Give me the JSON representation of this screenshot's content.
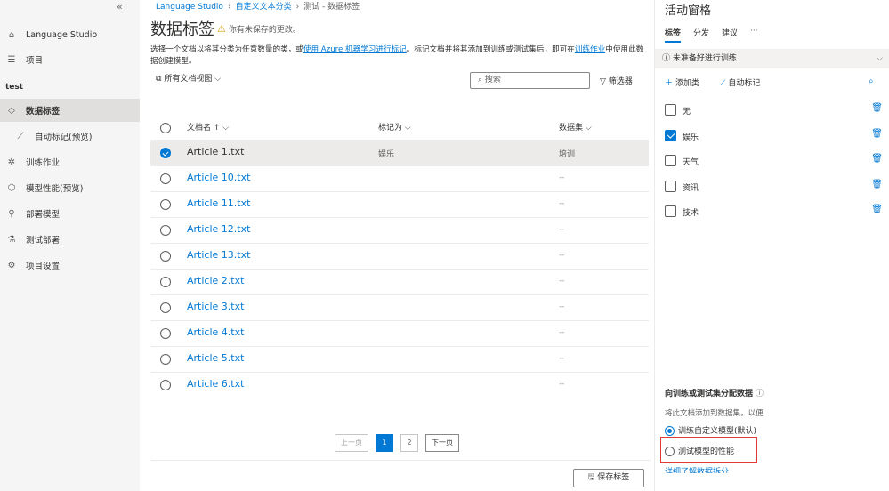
{
  "sidebar": {
    "collapse_glyph": "«",
    "items": [
      {
        "label": "Language Studio",
        "icon": "home-icon"
      },
      {
        "label": "项目",
        "icon": "list-icon"
      }
    ],
    "project_name": "test",
    "project_items": [
      {
        "label": "数据标签",
        "icon": "tag-icon",
        "active": true
      },
      {
        "label": "自动标记(预览)",
        "icon": "wand-icon",
        "sub": true
      },
      {
        "label": "训练作业",
        "icon": "training-icon"
      },
      {
        "label": "模型性能(预览)",
        "icon": "model-icon"
      },
      {
        "label": "部署模型",
        "icon": "deploy-icon"
      },
      {
        "label": "测试部署",
        "icon": "flask-icon"
      },
      {
        "label": "项目设置",
        "icon": "gear-icon"
      }
    ]
  },
  "breadcrumb": {
    "items": [
      "Language Studio",
      "自定义文本分类",
      "测试 - 数据标签"
    ]
  },
  "page": {
    "title": "数据标签",
    "warning": "你有未保存的更改。",
    "desc_part1": "选择一个文档以将其分类为任意数量的类，或",
    "desc_link1": "使用 Azure 机器学习进行标记",
    "desc_part2": "。标记文档并将其添加到训练或测试集后，即可在",
    "desc_link2": "训练作业",
    "desc_part3": "中使用此数据创建模型。",
    "view_selector": "所有文档视图",
    "search_placeholder": "搜索",
    "filter_label": "筛选器"
  },
  "table": {
    "headers": {
      "name": "文档名 ↑",
      "tag": "标记为",
      "dataset": "数据集"
    },
    "rows": [
      {
        "name": "Article 1.txt",
        "tag": "娱乐",
        "dataset": "培训",
        "selected": true
      },
      {
        "name": "Article 10.txt",
        "tag": "",
        "dataset": "--"
      },
      {
        "name": "Article 11.txt",
        "tag": "",
        "dataset": "--"
      },
      {
        "name": "Article 12.txt",
        "tag": "",
        "dataset": "--"
      },
      {
        "name": "Article 13.txt",
        "tag": "",
        "dataset": "--"
      },
      {
        "name": "Article 2.txt",
        "tag": "",
        "dataset": "--"
      },
      {
        "name": "Article 3.txt",
        "tag": "",
        "dataset": "--"
      },
      {
        "name": "Article 4.txt",
        "tag": "",
        "dataset": "--"
      },
      {
        "name": "Article 5.txt",
        "tag": "",
        "dataset": "--"
      },
      {
        "name": "Article 6.txt",
        "tag": "",
        "dataset": "--"
      }
    ]
  },
  "pager": {
    "prev": "上一页",
    "pages": [
      "1",
      "2"
    ],
    "current": "1",
    "next": "下一页"
  },
  "save_button": "保存标签",
  "pane": {
    "title": "活动窗格",
    "tabs": [
      "标签",
      "分发",
      "建议"
    ],
    "more": "···",
    "notice": "未准备好进行训练",
    "add_class": "添加类",
    "auto_label": "自动标记",
    "labels": [
      {
        "name": "无",
        "checked": false
      },
      {
        "name": "娱乐",
        "checked": true
      },
      {
        "name": "天气",
        "checked": false
      },
      {
        "name": "资讯",
        "checked": false
      },
      {
        "name": "技术",
        "checked": false
      }
    ],
    "assign_title": "向训练或测试集分配数据",
    "assign_desc": "将此文档添加到数据集，以便",
    "option_train": "训练自定义模型(默认)",
    "option_test": "测试模型的性能",
    "learn_more": "详细了解数据拆分"
  },
  "colors": {
    "accent": "#0078d4",
    "highlight": "#e03a3a",
    "warning": "#d29200"
  }
}
